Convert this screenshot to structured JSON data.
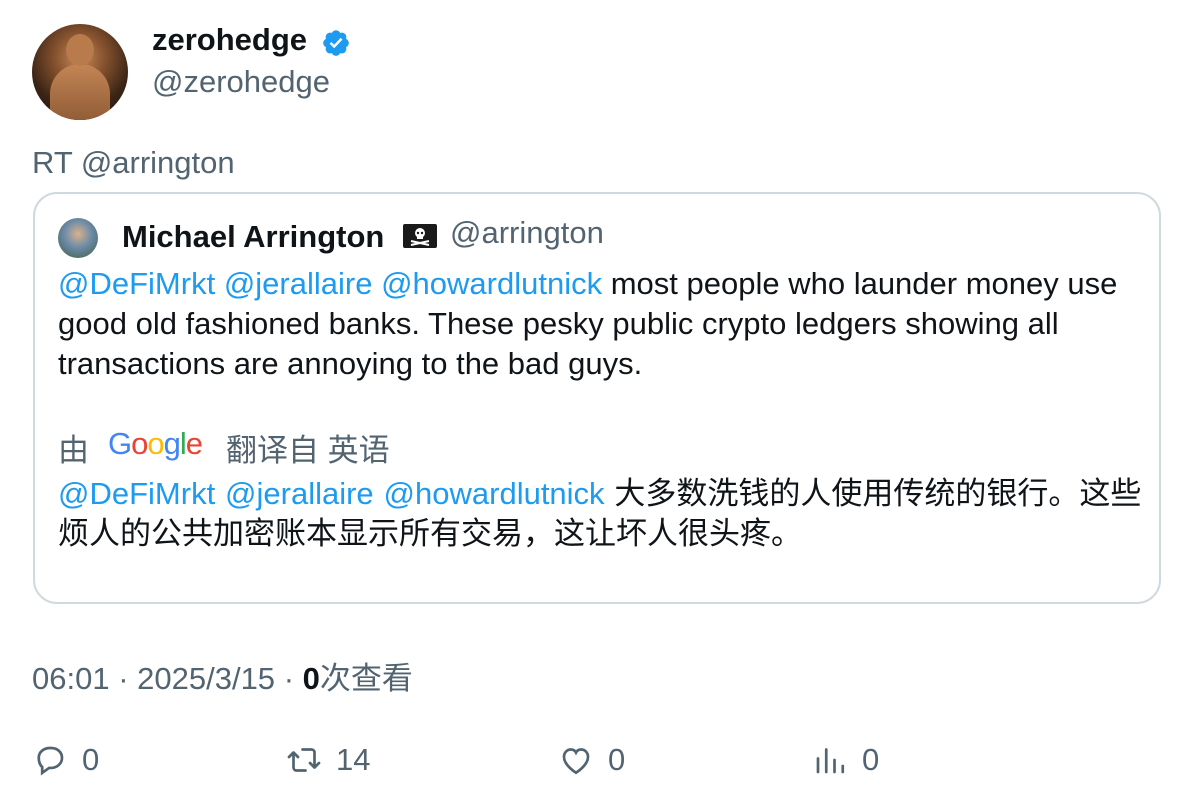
{
  "author": {
    "display_name": "zerohedge",
    "handle": "@zerohedge",
    "verified_color": "#1d9bf0"
  },
  "retweet_text": "RT @arrington",
  "quoted": {
    "display_name": "Michael Arrington",
    "flag": "pirate-flag-icon",
    "handle": "@arrington",
    "mentions": [
      "@DeFiMrkt",
      "@jerallaire",
      "@howardlutnick"
    ],
    "text": "most people who launder money use good old fashioned banks. These pesky public crypto ledgers showing all transactions are annoying to the bad guys.",
    "translation": {
      "by": "由",
      "provider": "Google",
      "label": "翻译自 英语",
      "text": "大多数洗钱的人使用传统的银行。这些烦人的公共加密账本显示所有交易，这让坏人很头疼。"
    }
  },
  "meta": {
    "time": "06:01",
    "date": "2025/3/15",
    "views_count": "0",
    "views_label": "次查看"
  },
  "actions": {
    "replies": "0",
    "retweets": "14",
    "likes": "0",
    "analytics": "0"
  }
}
